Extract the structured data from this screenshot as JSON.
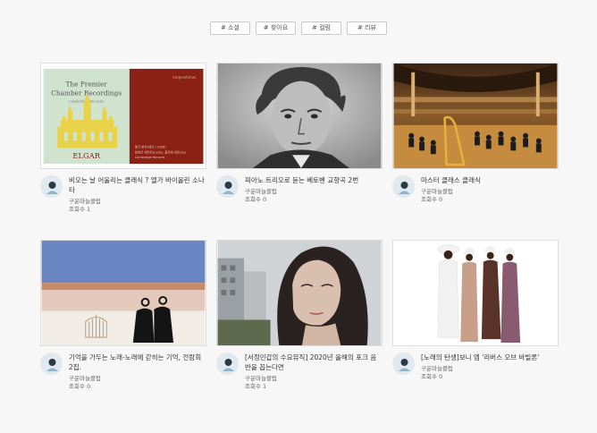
{
  "tabs": [
    "# 소셜",
    "# 찾아요",
    "# 컬럼",
    "# 리뷰"
  ],
  "videos": [
    {
      "title": "비오는 날 어울리는 클래식 ? 엘가 바이올린 소나타",
      "channel": "구운마늘클럽",
      "views": "조회수 1",
      "thumb_text": {
        "top": "The Premier",
        "mid": "Chamber Recordings",
        "name": "ELGAR",
        "small1": "엘가 현악5중주 (1928)",
        "small2": "랑데르 제라르(Cello), 플레셰 게토(by)",
        "small3": "Cambridge Records",
        "logo": "Cinpendulum"
      }
    },
    {
      "title": "피아노 트리오로 듣는 베토벤 교향곡 2번",
      "channel": "구운마늘클럽",
      "views": "조회수 0"
    },
    {
      "title": "마스터 클래스 클래식",
      "channel": "구운마늘클럽",
      "views": "조회수 0"
    },
    {
      "title": "기억을 가두는 노래-노래에 갇히는 기억, 전람회 2집.",
      "channel": "구운마늘클럽",
      "views": "조회수 0"
    },
    {
      "title": "[서정민갑의 수요뮤직] 2020년 올해의 포크 음반을 꼽는다면",
      "channel": "구운마늘클럽",
      "views": "조회수 1"
    },
    {
      "title": "[노래의 탄생]보니 엠 '리버스 오브 바빌론'",
      "channel": "구운마늘클럽",
      "views": "조회수 0"
    }
  ],
  "colors": {
    "background": "#f7f7f8",
    "elgar_red": "#8b2014",
    "elgar_yellow": "#e8d24a"
  }
}
